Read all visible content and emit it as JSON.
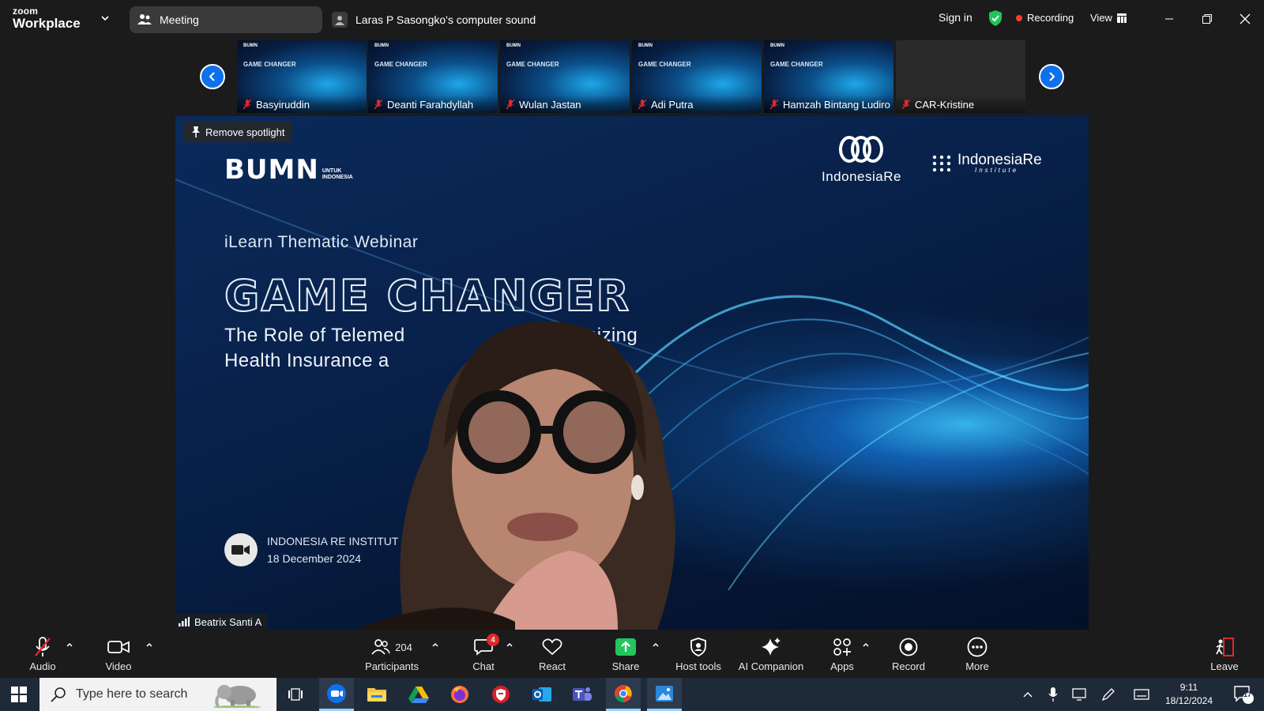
{
  "app": {
    "logo_line1": "zoom",
    "logo_line2": "Workplace",
    "meeting_label": "Meeting",
    "sound_label": "Laras P Sasongko's computer sound",
    "sign_in": "Sign in",
    "recording": "Recording",
    "view": "View"
  },
  "thumbnails": [
    {
      "name": "Basyiruddin"
    },
    {
      "name": "Deanti Farahdyllah"
    },
    {
      "name": "Wulan Jastan"
    },
    {
      "name": "Adi Putra"
    },
    {
      "name": "Hamzah Bintang Ludiro"
    },
    {
      "name": "CAR-Kristine"
    }
  ],
  "slide": {
    "bumn_big": "BUMN",
    "bumn_small1": "UNTUK",
    "bumn_small2": "INDONESIA",
    "ir_name": "IndonesiaRe",
    "iri_name": "IndonesiaRe",
    "iri_sub": "Institute",
    "ilearn": "iLearn Thematic Webinar",
    "game_changer": "GAME CHANGER",
    "sub1": "The Role of Telemed",
    "sub1b": "nizing",
    "sub2": "Health Insurance a",
    "org_line1": "INDONESIA RE INSTITUT",
    "org_line2": "18 December 2024"
  },
  "spotlight": {
    "remove_label": "Remove spotlight",
    "speaker_name": "Beatrix Santi A"
  },
  "toolbar": {
    "audio": "Audio",
    "video": "Video",
    "participants": "Participants",
    "participants_count": "204",
    "chat": "Chat",
    "chat_badge": "4",
    "react": "React",
    "share": "Share",
    "host_tools": "Host tools",
    "ai_companion": "AI Companion",
    "apps": "Apps",
    "record": "Record",
    "more": "More",
    "leave": "Leave"
  },
  "taskbar": {
    "search_placeholder": "Type here to search",
    "time": "9:11",
    "date": "18/12/2024",
    "notification_count": "17"
  },
  "colors": {
    "zoom_blue": "#0e71eb",
    "share_green": "#22c55e",
    "recording_red": "#ff3b30",
    "shield_green": "#23c45e"
  }
}
